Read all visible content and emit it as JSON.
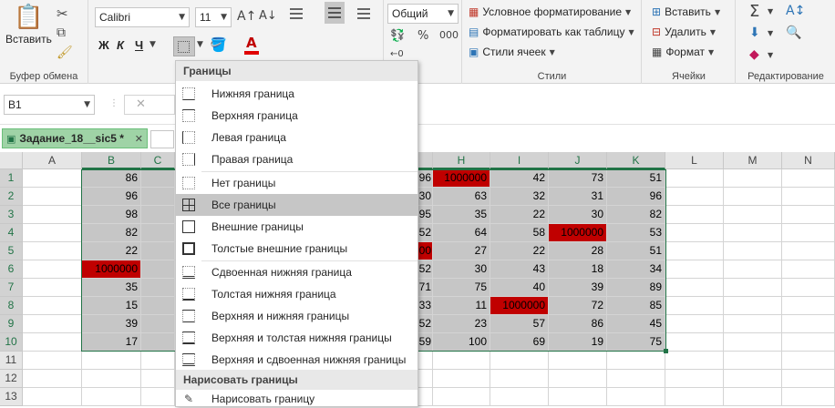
{
  "clipboard": {
    "paste_label": "Вставить",
    "group_label": "Буфер обмена"
  },
  "font": {
    "name": "Calibri",
    "size": "11",
    "bold": "Ж",
    "italic": "К",
    "underline": "Ч",
    "group_label": "Шр"
  },
  "number": {
    "format": "Общий"
  },
  "styles": {
    "cond": "Условное форматирование",
    "table": "Форматировать как таблицу",
    "cell": "Стили ячеек",
    "group_label": "Стили"
  },
  "cells": {
    "insert": "Вставить",
    "delete": "Удалить",
    "format": "Формат",
    "group_label": "Ячейки"
  },
  "editing": {
    "group_label": "Редактирование"
  },
  "formula_bar": {
    "name_box": "B1"
  },
  "sheet_tab": {
    "label": "Задание_18__sic5 *"
  },
  "columns": [
    "A",
    "B",
    "C",
    "H",
    "I",
    "J",
    "K",
    "L",
    "M",
    "N"
  ],
  "rows": [
    "1",
    "2",
    "3",
    "4",
    "5",
    "6",
    "7",
    "8",
    "9",
    "10",
    "11",
    "12",
    "13"
  ],
  "col_b": [
    "86",
    "96",
    "98",
    "82",
    "22",
    "1000000",
    "35",
    "15",
    "39",
    "17"
  ],
  "col_g_partial": [
    "96",
    "30",
    "95",
    "52",
    "00",
    "52",
    "71",
    "33",
    "52",
    "59"
  ],
  "col_h": [
    "1000000",
    "63",
    "35",
    "64",
    "27",
    "30",
    "75",
    "11",
    "23",
    "100"
  ],
  "col_i": [
    "42",
    "32",
    "22",
    "58",
    "22",
    "43",
    "40",
    "1000000",
    "57",
    "69"
  ],
  "col_j": [
    "73",
    "31",
    "30",
    "1000000",
    "28",
    "18",
    "39",
    "72",
    "86",
    "19"
  ],
  "col_k": [
    "51",
    "96",
    "82",
    "53",
    "51",
    "34",
    "89",
    "85",
    "45",
    "75"
  ],
  "highlight_color": "#c00000",
  "menu": {
    "header1": "Границы",
    "items": [
      "Нижняя граница",
      "Верхняя граница",
      "Левая граница",
      "Правая граница",
      "Нет границы",
      "Все границы",
      "Внешние границы",
      "Толстые внешние границы",
      "Сдвоенная нижняя граница",
      "Толстая нижняя граница",
      "Верхняя и нижняя границы",
      "Верхняя и толстая нижняя границы",
      "Верхняя и сдвоенная нижняя границы"
    ],
    "header2": "Нарисовать границы",
    "draw": "Нарисовать границу"
  }
}
